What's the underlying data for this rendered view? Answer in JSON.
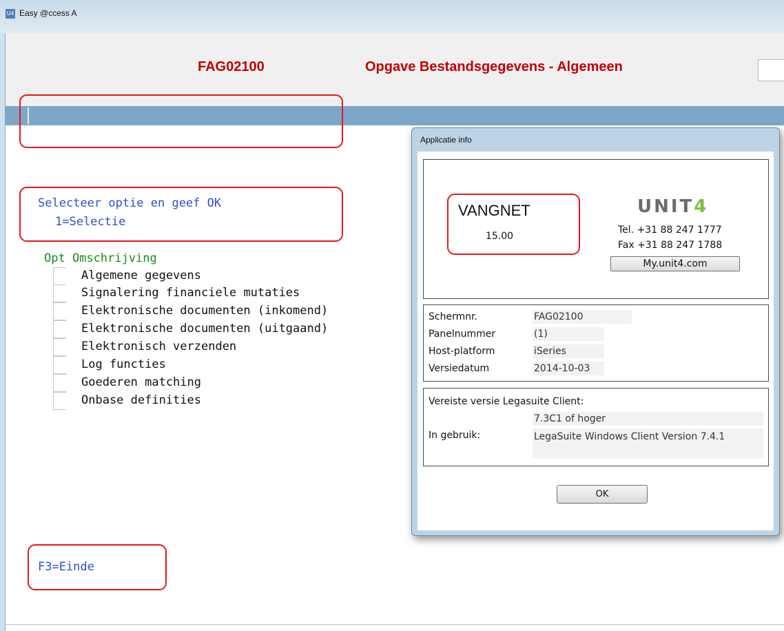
{
  "window": {
    "title": "Easy @ccess A",
    "icon": "U4"
  },
  "screen": {
    "program_id": "FAG02100",
    "program_title": "Opgave Bestandsgegevens - Algemeen",
    "instruction_line1": "Selecteer optie en geef OK",
    "instruction_line2": "1=Selectie",
    "column_header": "Opt Omschrijving",
    "options": [
      "Algemene gegevens",
      "Signalering financiele mutaties",
      "Elektronische documenten (inkomend)",
      "Elektronische documenten (uitgaand)",
      "Elektronisch verzenden",
      "Log functies",
      "Goederen matching",
      "Onbase definities"
    ],
    "function_keys": "F3=Einde"
  },
  "dialog": {
    "title": "Applicatie info",
    "product": "VANGNET",
    "version": "15.00",
    "logo_text": "UNIT",
    "logo_digit": "4",
    "tel": "Tel. +31 88 247 1777",
    "fax": "Fax +31 88 247 1788",
    "website_button": "My.unit4.com",
    "info_rows": [
      {
        "label": "Schermnr.",
        "value": "FAG02100"
      },
      {
        "label": "Panelnummer",
        "value": "(1)"
      },
      {
        "label": "Host-platform",
        "value": "iSeries"
      },
      {
        "label": "Versiedatum",
        "value": "2014-10-03"
      }
    ],
    "required_version_label": "Vereiste versie Legasuite Client:",
    "required_version_value": "7.3C1 of hoger",
    "in_use_label": "In gebruik:",
    "in_use_value": "LegaSuite Windows Client Version 7.4.1",
    "ok_button": "OK"
  },
  "colors": {
    "title_red": "#c00000",
    "instruction_blue": "#2a4fd0",
    "header_green": "#1a8a1a",
    "highlight_red": "#e8161b",
    "message_bar": "#7ea7c7",
    "logo_green": "#7ac143"
  }
}
